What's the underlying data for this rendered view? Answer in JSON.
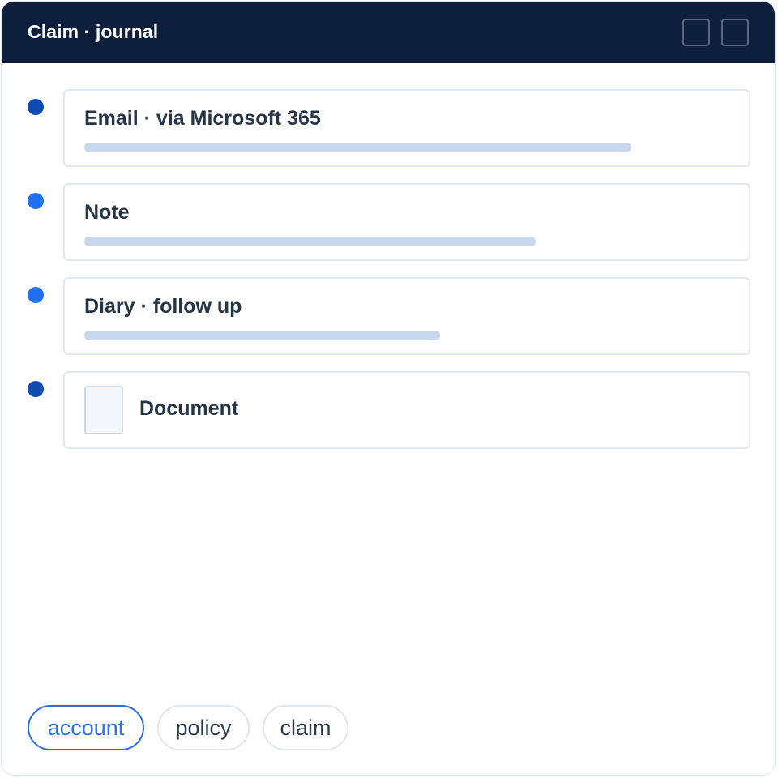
{
  "window": {
    "title": "Claim · journal"
  },
  "entries": [
    {
      "title": "Email · via Microsoft 365",
      "dot_color": "#0e4ab0",
      "bar_fraction": 0.8
    },
    {
      "title": "Note",
      "dot_color": "#1f6fee",
      "bar_fraction": 0.66
    },
    {
      "title": "Diary · follow up",
      "dot_color": "#1f6fee",
      "bar_fraction": 0.52
    },
    {
      "title": "Document",
      "dot_color": "#0e4ab0",
      "icon": "document-icon"
    }
  ],
  "chips": [
    {
      "label": "account",
      "active": true
    },
    {
      "label": "policy",
      "active": false
    },
    {
      "label": "claim",
      "active": false
    }
  ],
  "colors": {
    "titlebar": "#0d1f3c",
    "accent": "#2b6fe0",
    "bar": "#c8d8ea"
  }
}
